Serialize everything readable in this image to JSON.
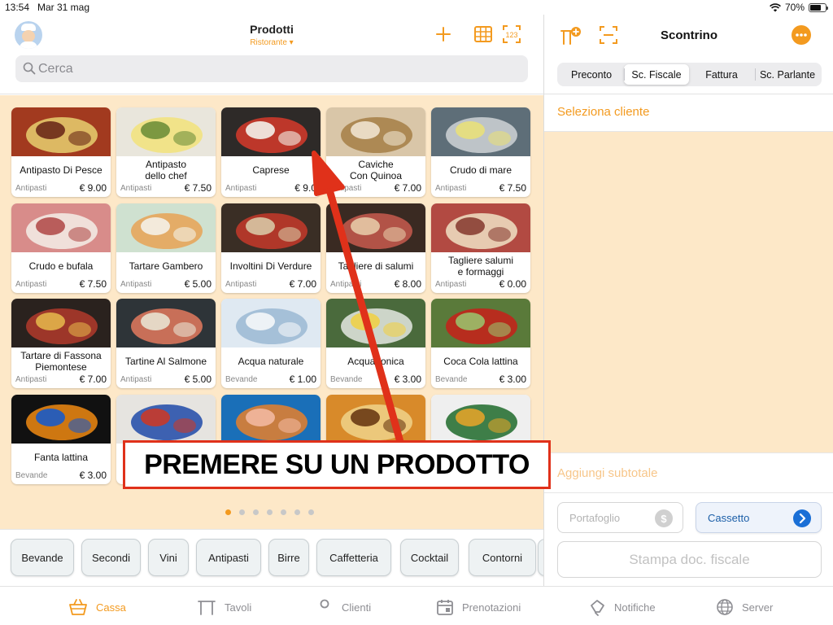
{
  "status_bar": {
    "time": "13:54",
    "date": "Mar 31 mag",
    "battery": "70%",
    "battery_level": 0.7
  },
  "header": {
    "title": "Prodotti",
    "subtitle": "Ristorante ▾",
    "search_placeholder": "Cerca"
  },
  "products": [
    {
      "name": "Antipasto Di Pesce",
      "category": "Antipasti",
      "price": "€ 9.00",
      "image_colors": [
        "#a23a1f",
        "#e8d070",
        "#6b2a18"
      ]
    },
    {
      "name": "Antipasto\ndello chef",
      "category": "Antipasti",
      "price": "€ 7.50",
      "image_colors": [
        "#e9e6dc",
        "#f2e27a",
        "#6f8f3a"
      ]
    },
    {
      "name": "Caprese",
      "category": "Antipasti",
      "price": "€ 9.0",
      "image_colors": [
        "#2e2a28",
        "#d63a2a",
        "#f3f1ea"
      ]
    },
    {
      "name": "Caviche\nCon Quinoa",
      "category": "Antipasti",
      "price": "€ 7.00",
      "image_colors": [
        "#d9c6a8",
        "#a57e45",
        "#efe3cf"
      ]
    },
    {
      "name": "Crudo di mare",
      "category": "Antipasti",
      "price": "€ 7.50",
      "image_colors": [
        "#5e6e78",
        "#cfd4d6",
        "#e8e07a"
      ]
    },
    {
      "name": "Crudo e bufala",
      "category": "Antipasti",
      "price": "€ 7.50",
      "image_colors": [
        "#d88c8a",
        "#f4efe8",
        "#b34f4d"
      ]
    },
    {
      "name": "Tartare Gambero",
      "category": "Antipasti",
      "price": "€ 5.00",
      "image_colors": [
        "#cfe1d0",
        "#e8a255",
        "#f4f1e8"
      ]
    },
    {
      "name": "Involtini Di Verdure",
      "category": "Antipasti",
      "price": "€ 7.00",
      "image_colors": [
        "#3a2e25",
        "#c5382a",
        "#d8c7a4"
      ]
    },
    {
      "name": "Tagliere di salumi",
      "category": "Antipasti",
      "price": "€ 8.00",
      "image_colors": [
        "#3a2a22",
        "#c85a4e",
        "#e6c9a6"
      ]
    },
    {
      "name": "Tagliere salumi\ne formaggi",
      "category": "Antipasti",
      "price": "€ 0.00",
      "image_colors": [
        "#b24a42",
        "#f0e2c4",
        "#8a3f34"
      ]
    },
    {
      "name": "Tartare di Fassona\nPiemontese",
      "category": "Antipasti",
      "price": "€ 7.00",
      "image_colors": [
        "#2a221e",
        "#b23a2c",
        "#e3b34a"
      ]
    },
    {
      "name": "Tartine Al Salmone",
      "category": "Antipasti",
      "price": "€ 5.00",
      "image_colors": [
        "#2e3438",
        "#e37a5e",
        "#e8e2d2"
      ]
    },
    {
      "name": "Acqua naturale",
      "category": "Bevande",
      "price": "€ 1.00",
      "image_colors": [
        "#dfe9f2",
        "#9bb9d4",
        "#f5f7fa"
      ]
    },
    {
      "name": "Acqua tonica",
      "category": "Bevande",
      "price": "€ 3.00",
      "image_colors": [
        "#4a6a3c",
        "#e4e8e2",
        "#f0d048"
      ]
    },
    {
      "name": "Coca Cola lattina",
      "category": "Bevande",
      "price": "€ 3.00",
      "image_colors": [
        "#5a7a3a",
        "#c8201a",
        "#9abf6a"
      ]
    },
    {
      "name": "Fanta lattina",
      "category": "Bevande",
      "price": "€ 3.00",
      "image_colors": [
        "#111111",
        "#f08a12",
        "#1a5ac8"
      ]
    },
    {
      "name": "",
      "category": "",
      "price": "",
      "image_colors": [
        "#e6e4e0",
        "#1e4aa8",
        "#c83a2a"
      ]
    },
    {
      "name": "",
      "category": "",
      "price": "",
      "image_colors": [
        "#1a6fb8",
        "#e8802a",
        "#f2b8a0"
      ]
    },
    {
      "name": "",
      "category": "",
      "price": "",
      "image_colors": [
        "#d88a2a",
        "#f0d28a",
        "#6a3a14"
      ]
    },
    {
      "name": "",
      "category": "",
      "price": "",
      "image_colors": [
        "#efefef",
        "#1e6a2a",
        "#e0a32a"
      ]
    }
  ],
  "page_dots": {
    "count": 7,
    "active_index": 0
  },
  "categories": [
    "Bevande",
    "Secondi",
    "Vini",
    "Antipasti",
    "Birre",
    "Caffetteria",
    "Cocktail",
    "Contorni",
    ""
  ],
  "tabs": [
    {
      "label": "Cassa",
      "icon": "basket-icon",
      "active": true
    },
    {
      "label": "Tavoli",
      "icon": "table-icon",
      "active": false
    },
    {
      "label": "Clienti",
      "icon": "person-icon",
      "active": false
    },
    {
      "label": "Prenotazioni",
      "icon": "calendar-icon",
      "active": false
    },
    {
      "label": "Notifiche",
      "icon": "bell-icon",
      "active": false
    },
    {
      "label": "Server",
      "icon": "globe-icon",
      "active": false
    }
  ],
  "receipt": {
    "title": "Scontrino",
    "segments": [
      "Preconto",
      "Sc. Fiscale",
      "Fattura",
      "Sc. Parlante"
    ],
    "active_segment": 1,
    "select_client": "Seleziona cliente",
    "add_subtotal": "Aggiungi subtotale",
    "wallet_label": "Portafoglio",
    "wallet_icon_glyph": "$",
    "drawer_label": "Cassetto",
    "print_label": "Stampa doc. fiscale"
  },
  "overlay": {
    "text": "PREMERE SU UN PRODOTTO"
  },
  "colors": {
    "accent": "#f39a1f",
    "background": "#fde8c8",
    "link_blue": "#1a6fd6",
    "annotation_red": "#e0311a"
  }
}
